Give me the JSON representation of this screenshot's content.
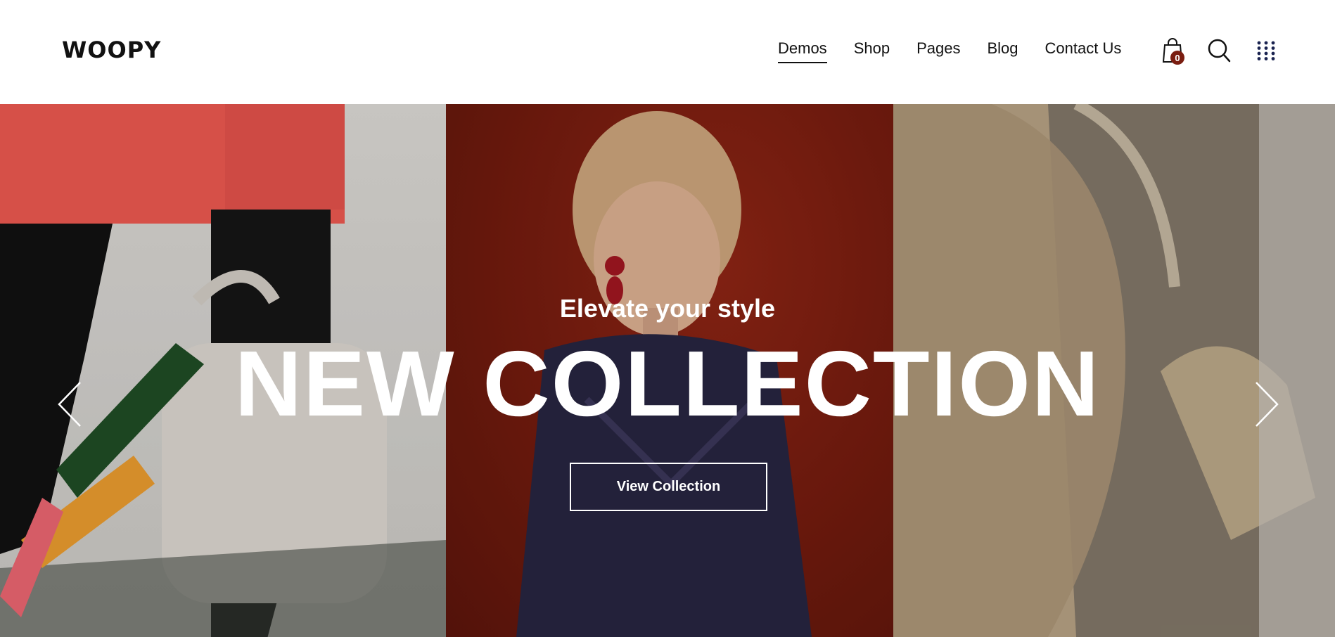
{
  "brand": {
    "name": "WOOPY"
  },
  "nav": {
    "items": [
      {
        "label": "Demos",
        "active": true
      },
      {
        "label": "Shop",
        "active": false
      },
      {
        "label": "Pages",
        "active": false
      },
      {
        "label": "Blog",
        "active": false
      },
      {
        "label": "Contact Us",
        "active": false
      }
    ]
  },
  "header_actions": {
    "cart": {
      "icon": "shopping-bag-icon",
      "count": "0",
      "badge_color": "#7a1d10"
    },
    "search": {
      "icon": "search-icon"
    },
    "menu": {
      "icon": "grid-menu-icon"
    }
  },
  "hero": {
    "subtitle": "Elevate your style",
    "headline": "NEW COLLECTION",
    "cta_label": "View Collection",
    "prev_icon": "chevron-left-icon",
    "next_icon": "chevron-right-icon",
    "panel_colors": [
      "#d3d1cd",
      "#7a1d10",
      "#9c8f7b"
    ]
  }
}
